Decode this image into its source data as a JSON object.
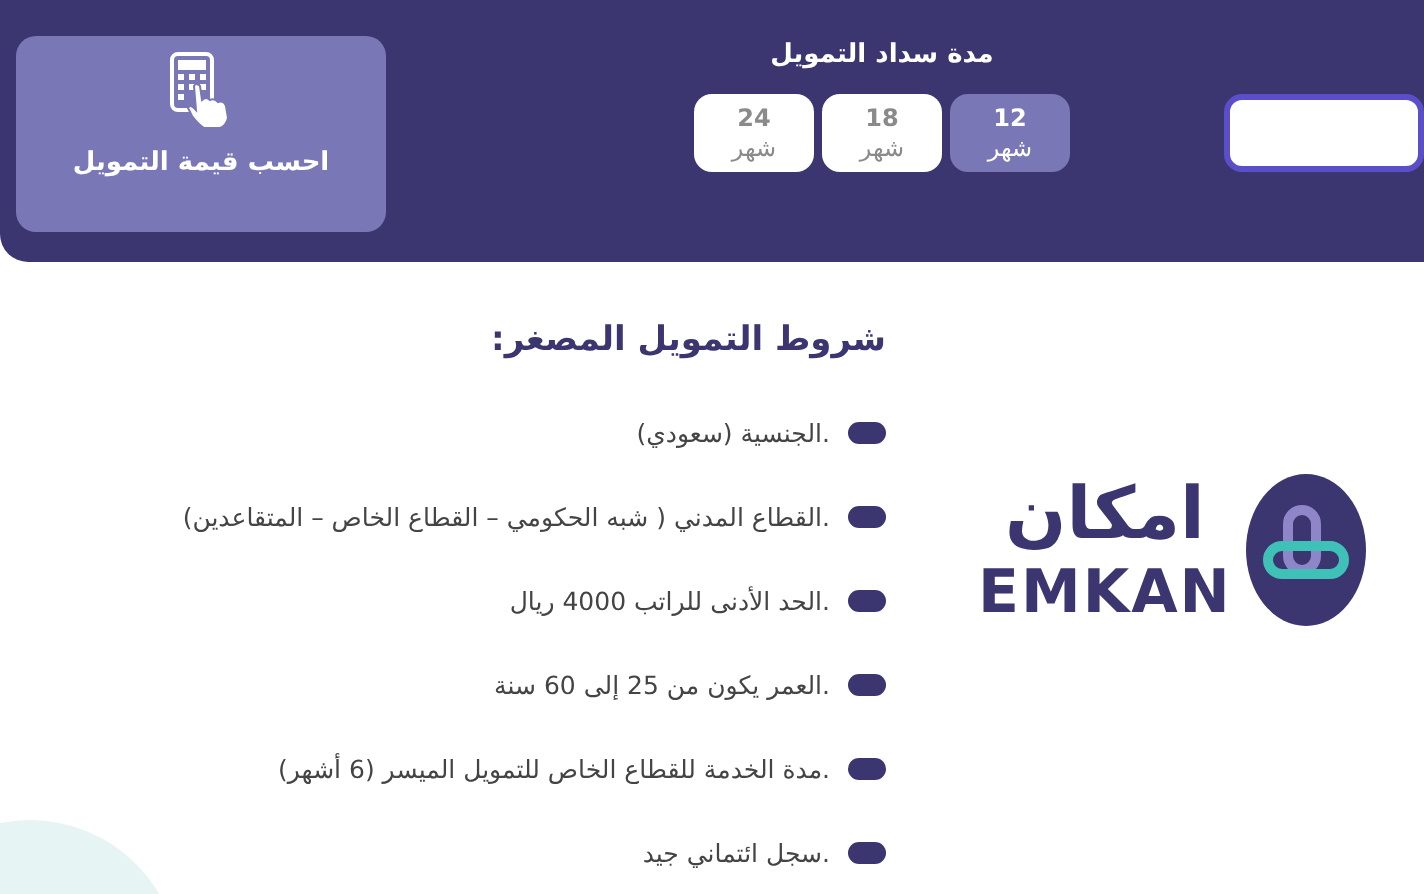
{
  "calculator": {
    "button_label": "احسب قيمة التمويل"
  },
  "repayment_period": {
    "title": "مدة سداد التمويل",
    "options": [
      {
        "value": "12",
        "unit": "شهر",
        "selected": true
      },
      {
        "value": "18",
        "unit": "شهر",
        "selected": false
      },
      {
        "value": "24",
        "unit": "شهر",
        "selected": false
      }
    ]
  },
  "conditions": {
    "heading": "شروط التمويل المصغر:",
    "items": [
      ".الجنسية (سعودي)",
      ".القطاع المدني ( شبه الحكومي – القطاع الخاص – المتقاعدين)",
      ".الحد الأدنى للراتب 4000 ريال",
      ".العمر يكون من 25 إلى 60 سنة",
      ".مدة الخدمة للقطاع الخاص للتمويل الميسر (6 أشهر)",
      ".سجل ائتماني جيد"
    ]
  },
  "logo": {
    "arabic": "امكان",
    "latin": "EMKAN"
  }
}
